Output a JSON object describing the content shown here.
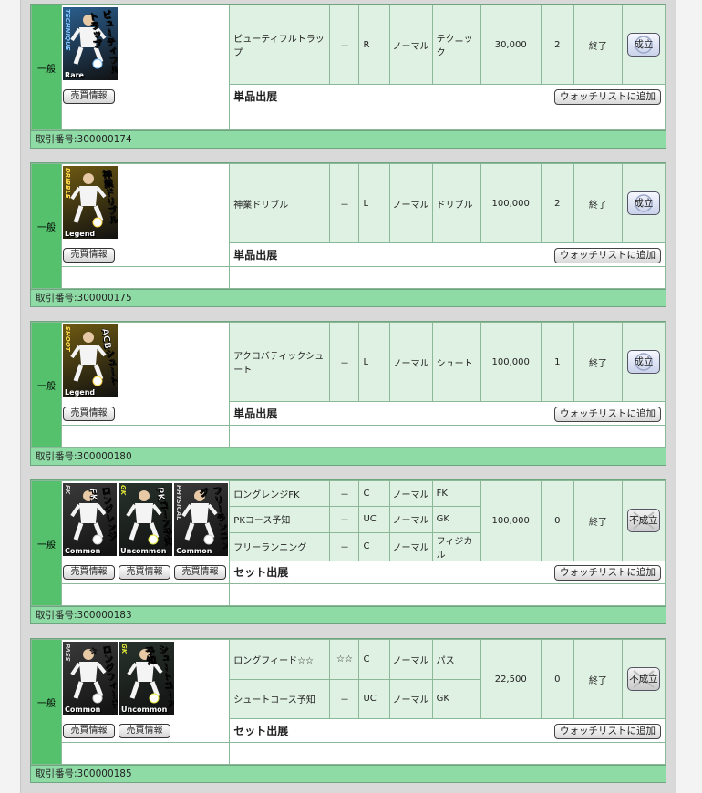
{
  "category_label": "一般",
  "buy_info_label": "売買情報",
  "watchlist_label": "ウォッチリストに追加",
  "listings": [
    {
      "id_text": "取引番号:300000174",
      "type_label": "単品出展",
      "price": "30,000",
      "bids": "2",
      "state": "終了",
      "result": "成立",
      "result_ok": true,
      "cards": [
        {
          "side": "TECHNIQUE",
          "name": "ビューティフルトラップ",
          "rarity": "Rare",
          "bg": "#2b5f8f",
          "accent": "#7ec3ff"
        }
      ],
      "skills": [
        {
          "name": "ビューティフルトラップ",
          "stars": "－",
          "rank": "R",
          "kind": "ノーマル",
          "category": "テクニック"
        }
      ]
    },
    {
      "id_text": "取引番号:300000175",
      "type_label": "単品出展",
      "price": "100,000",
      "bids": "2",
      "state": "終了",
      "result": "成立",
      "result_ok": true,
      "cards": [
        {
          "side": "DRIBBLE",
          "name": "神業ドリブル",
          "rarity": "Legend",
          "bg": "#6e5a12",
          "accent": "#ffd84a"
        }
      ],
      "skills": [
        {
          "name": "神業ドリブル",
          "stars": "－",
          "rank": "L",
          "kind": "ノーマル",
          "category": "ドリブル"
        }
      ]
    },
    {
      "id_text": "取引番号:300000180",
      "type_label": "単品出展",
      "price": "100,000",
      "bids": "1",
      "state": "終了",
      "result": "成立",
      "result_ok": true,
      "cards": [
        {
          "side": "SHOOT",
          "name": "ACBシュート",
          "rarity": "Legend",
          "bg": "#6e5a12",
          "accent": "#ffd84a"
        }
      ],
      "skills": [
        {
          "name": "アクロバティックシュート",
          "stars": "－",
          "rank": "L",
          "kind": "ノーマル",
          "category": "シュート"
        }
      ]
    },
    {
      "id_text": "取引番号:300000183",
      "type_label": "セット出展",
      "price": "100,000",
      "bids": "0",
      "state": "終了",
      "result": "不成立",
      "result_ok": false,
      "cards": [
        {
          "side": "FK",
          "name": "ロングレンジFK",
          "rarity": "Common",
          "bg": "#3a3a3a",
          "accent": "#cfcfcf"
        },
        {
          "side": "GK",
          "name": "PKコース予知",
          "rarity": "Uncommon",
          "bg": "#28332c",
          "accent": "#e2e83a"
        },
        {
          "side": "PHYSICAL",
          "name": "フリーランニング",
          "rarity": "Common",
          "bg": "#3a3a3a",
          "accent": "#cfcfcf"
        }
      ],
      "skills": [
        {
          "name": "ロングレンジFK",
          "stars": "－",
          "rank": "C",
          "kind": "ノーマル",
          "category": "FK"
        },
        {
          "name": "PKコース予知",
          "stars": "－",
          "rank": "UC",
          "kind": "ノーマル",
          "category": "GK"
        },
        {
          "name": "フリーランニング",
          "stars": "－",
          "rank": "C",
          "kind": "ノーマル",
          "category": "フィジカル"
        }
      ]
    },
    {
      "id_text": "取引番号:300000185",
      "type_label": "セット出展",
      "price": "22,500",
      "bids": "0",
      "state": "終了",
      "result": "不成立",
      "result_ok": false,
      "cards": [
        {
          "side": "PASS",
          "name": "ロングフィード☆",
          "rarity": "Common",
          "bg": "#3a3a3a",
          "accent": "#cfcfcf"
        },
        {
          "side": "GK",
          "name": "シュートコース予知",
          "rarity": "Uncommon",
          "bg": "#28332c",
          "accent": "#e2e83a"
        }
      ],
      "skills": [
        {
          "name": "ロングフィード☆☆",
          "stars": "☆☆",
          "rank": "C",
          "kind": "ノーマル",
          "category": "パス"
        },
        {
          "name": "シュートコース予知",
          "stars": "－",
          "rank": "UC",
          "kind": "ノーマル",
          "category": "GK"
        }
      ]
    }
  ]
}
